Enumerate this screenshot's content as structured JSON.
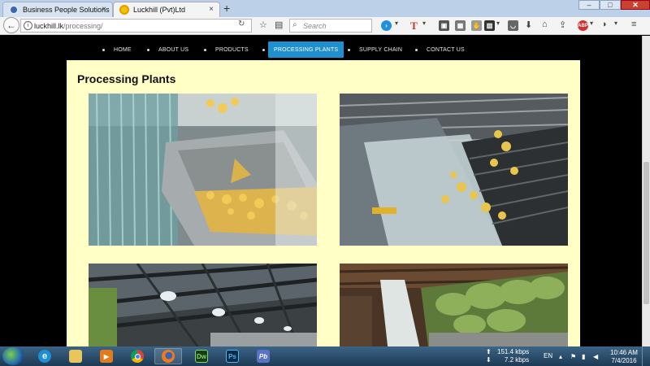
{
  "browser": {
    "tabs": [
      {
        "title": "Business People Solutions",
        "active": false
      },
      {
        "title": "Luckhill (Pvt)Ltd",
        "active": true
      }
    ],
    "new_tab_symbol": "+",
    "close_symbol": "×",
    "url_host": "luckhill.lk",
    "url_path": "/processing/",
    "search_placeholder": "Search",
    "window_controls": {
      "minimize": "–",
      "maximize": "□",
      "close": "✕"
    }
  },
  "site": {
    "menu": [
      {
        "label": "HOME",
        "active": false
      },
      {
        "label": "ABOUT US",
        "active": false
      },
      {
        "label": "PRODUCTS",
        "active": false
      },
      {
        "label": "PROCESSING PLANTS",
        "active": true
      },
      {
        "label": "SUPPLY CHAIN",
        "active": false
      },
      {
        "label": "CONTACT US",
        "active": false
      }
    ],
    "page_title": "Processing Plants",
    "colors": {
      "panel": "#ffffc6",
      "active_menu": "#1e8fcf",
      "background": "#000000"
    }
  },
  "taskbar": {
    "apps": [
      {
        "name": "internet-explorer-icon",
        "label": "e",
        "open": false
      },
      {
        "name": "file-explorer-icon",
        "label": "",
        "open": false
      },
      {
        "name": "media-player-icon",
        "label": "▶",
        "open": false
      },
      {
        "name": "chrome-icon",
        "label": "",
        "open": false
      },
      {
        "name": "firefox-icon",
        "label": "",
        "open": true
      },
      {
        "name": "dreamweaver-icon",
        "label": "Dw",
        "open": false
      },
      {
        "name": "photoshop-icon",
        "label": "Ps",
        "open": false
      },
      {
        "name": "pb-app-icon",
        "label": "Pb",
        "open": false
      }
    ],
    "net_up": "151.4 kbps",
    "net_down": "7.2 kbps",
    "language": "EN",
    "time": "10:46 AM",
    "date": "7/4/2016"
  }
}
